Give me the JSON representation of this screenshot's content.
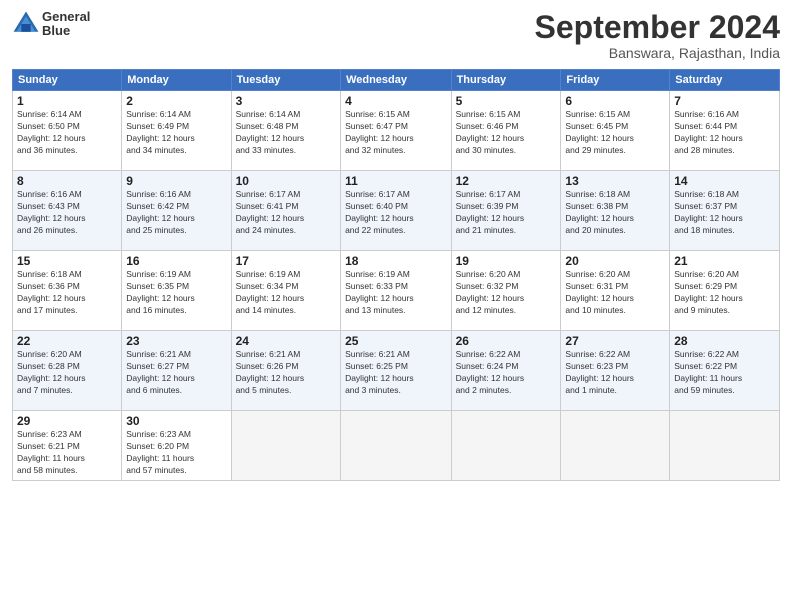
{
  "header": {
    "logo_line1": "General",
    "logo_line2": "Blue",
    "month": "September 2024",
    "location": "Banswara, Rajasthan, India"
  },
  "weekdays": [
    "Sunday",
    "Monday",
    "Tuesday",
    "Wednesday",
    "Thursday",
    "Friday",
    "Saturday"
  ],
  "weeks": [
    [
      {
        "day": "1",
        "info": "Sunrise: 6:14 AM\nSunset: 6:50 PM\nDaylight: 12 hours\nand 36 minutes."
      },
      {
        "day": "2",
        "info": "Sunrise: 6:14 AM\nSunset: 6:49 PM\nDaylight: 12 hours\nand 34 minutes."
      },
      {
        "day": "3",
        "info": "Sunrise: 6:14 AM\nSunset: 6:48 PM\nDaylight: 12 hours\nand 33 minutes."
      },
      {
        "day": "4",
        "info": "Sunrise: 6:15 AM\nSunset: 6:47 PM\nDaylight: 12 hours\nand 32 minutes."
      },
      {
        "day": "5",
        "info": "Sunrise: 6:15 AM\nSunset: 6:46 PM\nDaylight: 12 hours\nand 30 minutes."
      },
      {
        "day": "6",
        "info": "Sunrise: 6:15 AM\nSunset: 6:45 PM\nDaylight: 12 hours\nand 29 minutes."
      },
      {
        "day": "7",
        "info": "Sunrise: 6:16 AM\nSunset: 6:44 PM\nDaylight: 12 hours\nand 28 minutes."
      }
    ],
    [
      {
        "day": "8",
        "info": "Sunrise: 6:16 AM\nSunset: 6:43 PM\nDaylight: 12 hours\nand 26 minutes."
      },
      {
        "day": "9",
        "info": "Sunrise: 6:16 AM\nSunset: 6:42 PM\nDaylight: 12 hours\nand 25 minutes."
      },
      {
        "day": "10",
        "info": "Sunrise: 6:17 AM\nSunset: 6:41 PM\nDaylight: 12 hours\nand 24 minutes."
      },
      {
        "day": "11",
        "info": "Sunrise: 6:17 AM\nSunset: 6:40 PM\nDaylight: 12 hours\nand 22 minutes."
      },
      {
        "day": "12",
        "info": "Sunrise: 6:17 AM\nSunset: 6:39 PM\nDaylight: 12 hours\nand 21 minutes."
      },
      {
        "day": "13",
        "info": "Sunrise: 6:18 AM\nSunset: 6:38 PM\nDaylight: 12 hours\nand 20 minutes."
      },
      {
        "day": "14",
        "info": "Sunrise: 6:18 AM\nSunset: 6:37 PM\nDaylight: 12 hours\nand 18 minutes."
      }
    ],
    [
      {
        "day": "15",
        "info": "Sunrise: 6:18 AM\nSunset: 6:36 PM\nDaylight: 12 hours\nand 17 minutes."
      },
      {
        "day": "16",
        "info": "Sunrise: 6:19 AM\nSunset: 6:35 PM\nDaylight: 12 hours\nand 16 minutes."
      },
      {
        "day": "17",
        "info": "Sunrise: 6:19 AM\nSunset: 6:34 PM\nDaylight: 12 hours\nand 14 minutes."
      },
      {
        "day": "18",
        "info": "Sunrise: 6:19 AM\nSunset: 6:33 PM\nDaylight: 12 hours\nand 13 minutes."
      },
      {
        "day": "19",
        "info": "Sunrise: 6:20 AM\nSunset: 6:32 PM\nDaylight: 12 hours\nand 12 minutes."
      },
      {
        "day": "20",
        "info": "Sunrise: 6:20 AM\nSunset: 6:31 PM\nDaylight: 12 hours\nand 10 minutes."
      },
      {
        "day": "21",
        "info": "Sunrise: 6:20 AM\nSunset: 6:29 PM\nDaylight: 12 hours\nand 9 minutes."
      }
    ],
    [
      {
        "day": "22",
        "info": "Sunrise: 6:20 AM\nSunset: 6:28 PM\nDaylight: 12 hours\nand 7 minutes."
      },
      {
        "day": "23",
        "info": "Sunrise: 6:21 AM\nSunset: 6:27 PM\nDaylight: 12 hours\nand 6 minutes."
      },
      {
        "day": "24",
        "info": "Sunrise: 6:21 AM\nSunset: 6:26 PM\nDaylight: 12 hours\nand 5 minutes."
      },
      {
        "day": "25",
        "info": "Sunrise: 6:21 AM\nSunset: 6:25 PM\nDaylight: 12 hours\nand 3 minutes."
      },
      {
        "day": "26",
        "info": "Sunrise: 6:22 AM\nSunset: 6:24 PM\nDaylight: 12 hours\nand 2 minutes."
      },
      {
        "day": "27",
        "info": "Sunrise: 6:22 AM\nSunset: 6:23 PM\nDaylight: 12 hours\nand 1 minute."
      },
      {
        "day": "28",
        "info": "Sunrise: 6:22 AM\nSunset: 6:22 PM\nDaylight: 11 hours\nand 59 minutes."
      }
    ],
    [
      {
        "day": "29",
        "info": "Sunrise: 6:23 AM\nSunset: 6:21 PM\nDaylight: 11 hours\nand 58 minutes."
      },
      {
        "day": "30",
        "info": "Sunrise: 6:23 AM\nSunset: 6:20 PM\nDaylight: 11 hours\nand 57 minutes."
      },
      {
        "day": "",
        "info": ""
      },
      {
        "day": "",
        "info": ""
      },
      {
        "day": "",
        "info": ""
      },
      {
        "day": "",
        "info": ""
      },
      {
        "day": "",
        "info": ""
      }
    ]
  ]
}
